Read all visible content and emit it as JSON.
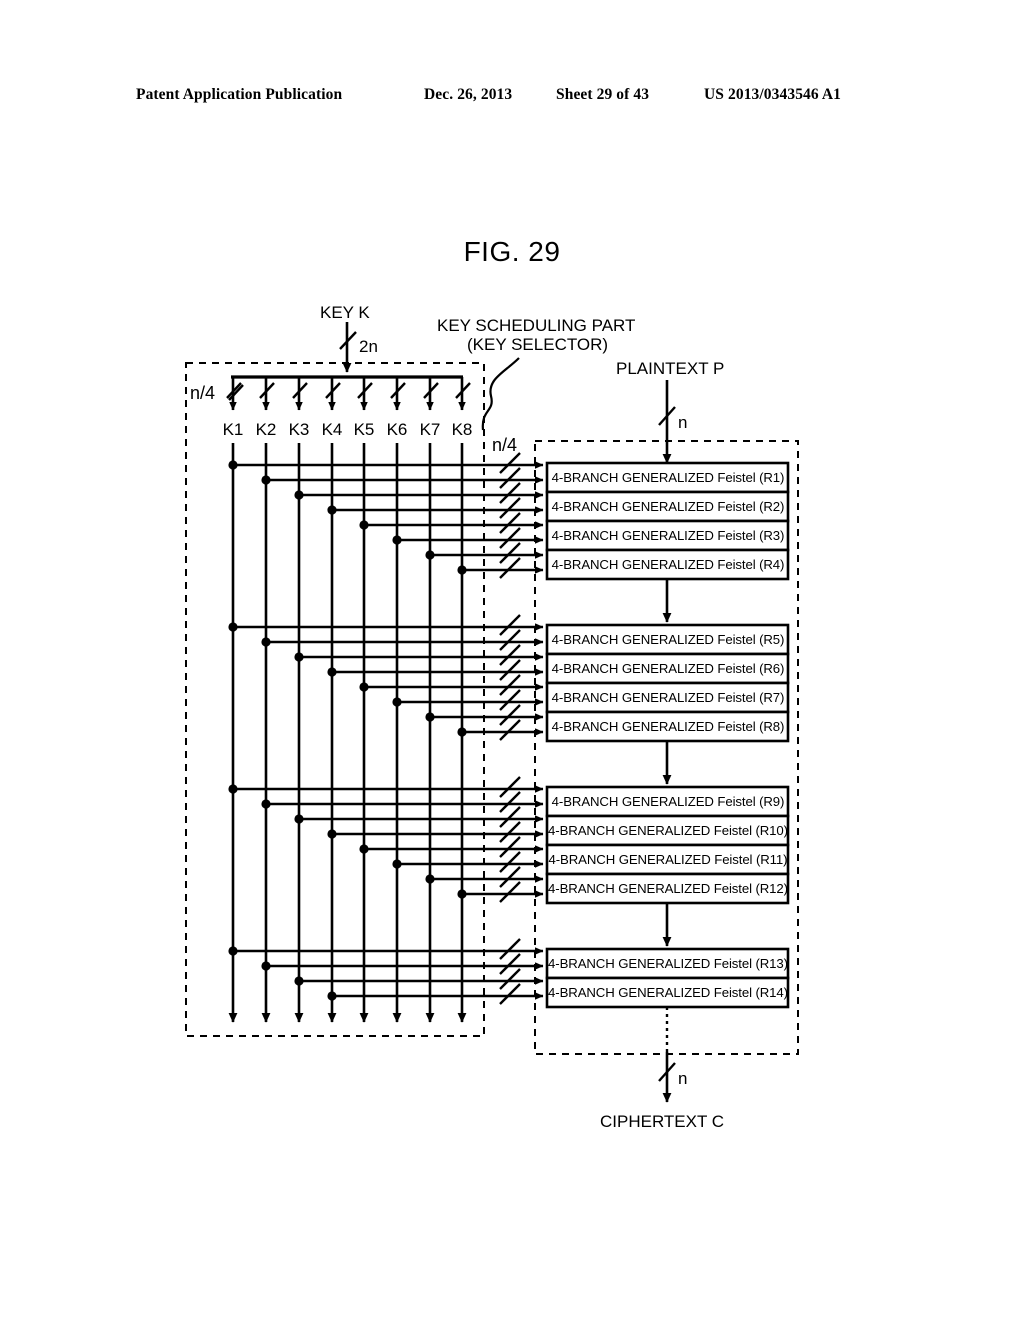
{
  "header": {
    "publication": "Patent Application Publication",
    "date": "Dec. 26, 2013",
    "sheet": "Sheet 29 of 43",
    "patent_number": "US 2013/0343546 A1"
  },
  "figure": {
    "title": "FIG. 29"
  },
  "labels": {
    "key_k": "KEY K",
    "key_width": "2n",
    "key_scheduling_line1": "KEY SCHEDULING PART",
    "key_scheduling_line2": "(KEY SELECTOR)",
    "plaintext": "PLAINTEXT P",
    "plaintext_width": "n",
    "ciphertext": "CIPHERTEXT C",
    "ciphertext_width": "n",
    "subkey_width_left": "n/4",
    "subkey_width_right": "n/4"
  },
  "keys": [
    "K1",
    "K2",
    "K3",
    "K4",
    "K5",
    "K6",
    "K7",
    "K8"
  ],
  "rounds": {
    "groups": [
      {
        "boxes": [
          "4-BRANCH GENERALIZED Feistel (R1)",
          "4-BRANCH GENERALIZED Feistel (R2)",
          "4-BRANCH GENERALIZED Feistel (R3)",
          "4-BRANCH GENERALIZED Feistel (R4)"
        ],
        "key_order": [
          "K1",
          "K2",
          "K3",
          "K4",
          "K5",
          "K6",
          "K7",
          "K8"
        ]
      },
      {
        "boxes": [
          "4-BRANCH GENERALIZED Feistel (R5)",
          "4-BRANCH GENERALIZED Feistel (R6)",
          "4-BRANCH GENERALIZED Feistel (R7)",
          "4-BRANCH GENERALIZED Feistel (R8)"
        ],
        "key_order": [
          "K1",
          "K2",
          "K3",
          "K4",
          "K5",
          "K6",
          "K7",
          "K8"
        ]
      },
      {
        "boxes": [
          "4-BRANCH GENERALIZED Feistel (R9)",
          "4-BRANCH GENERALIZED Feistel (R10)",
          "4-BRANCH GENERALIZED Feistel (R11)",
          "4-BRANCH GENERALIZED Feistel (R12)"
        ],
        "key_order": [
          "K1",
          "K2",
          "K3",
          "K4",
          "K5",
          "K6",
          "K7",
          "K8"
        ]
      },
      {
        "boxes": [
          "4-BRANCH GENERALIZED Feistel (R13)",
          "4-BRANCH GENERALIZED Feistel (R14)"
        ],
        "key_order": [
          "K1",
          "K2",
          "K3",
          "K4"
        ]
      }
    ]
  },
  "colors": {
    "ink": "#000000",
    "paper": "#ffffff"
  }
}
